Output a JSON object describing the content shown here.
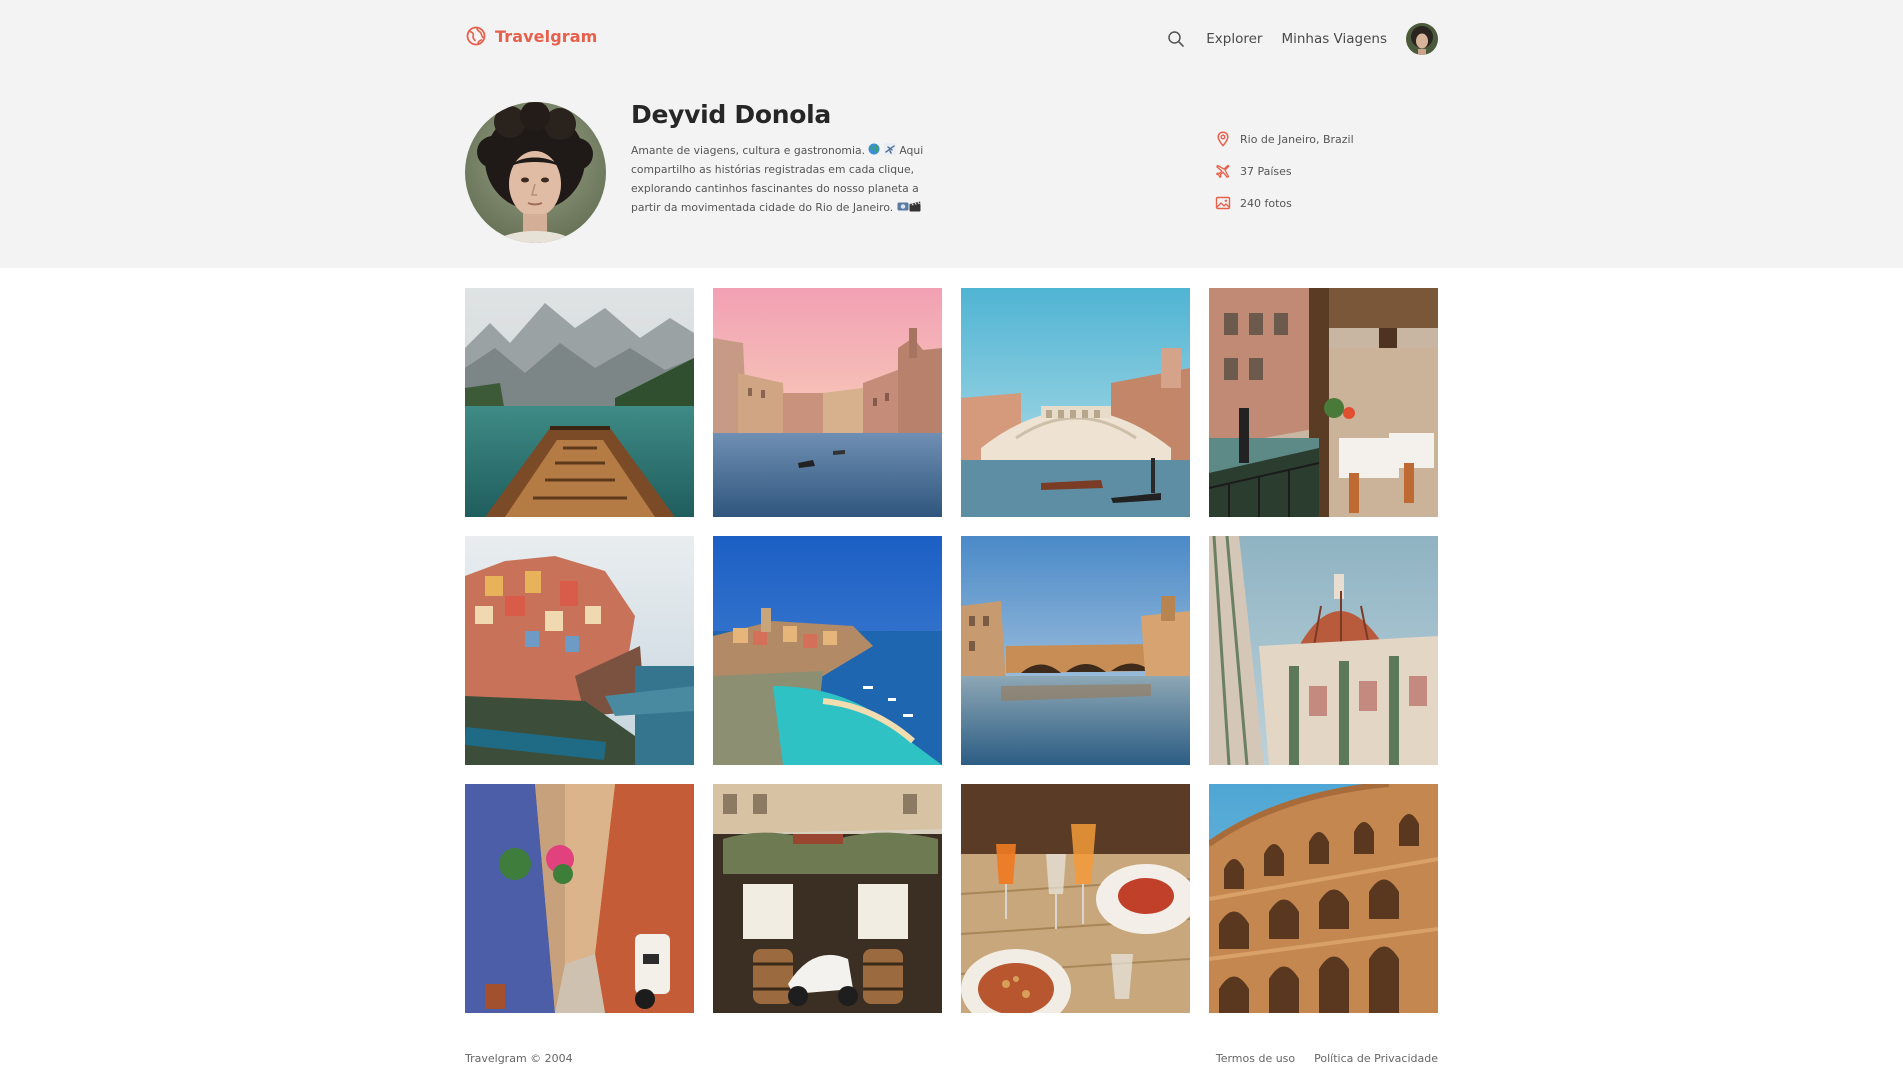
{
  "brand": {
    "name": "Travelgram",
    "accent_color": "#e8604c",
    "icon": "globe-icon"
  },
  "nav": {
    "search_icon": "search-icon",
    "links": [
      {
        "label": "Explorer"
      },
      {
        "label": "Minhas Viagens"
      }
    ],
    "avatar": "user-avatar"
  },
  "profile": {
    "name": "Deyvid Donola",
    "bio": "Amante de viagens, cultura e gastronomia. 🌍✈️ Aqui compartilho as histórias registradas em cada clique, explorando cantinhos fascinantes do nosso planeta a partir da movimentada cidade do Rio de Janeiro. 📷🎬",
    "bio_plain": "Amante de viagens, cultura e gastronomia.",
    "bio_rest": "Aqui compartilho as histórias registradas em cada clique, explorando cantinhos fascinantes do nosso planeta a partir da movimentada cidade do Rio de Janeiro.",
    "stats": [
      {
        "icon": "map-pin-icon",
        "label": "Rio de Janeiro, Brazil"
      },
      {
        "icon": "plane-icon",
        "label": "37 Países"
      },
      {
        "icon": "image-icon",
        "label": "240 fotos"
      }
    ]
  },
  "gallery": {
    "photos": [
      {
        "subject": "lake boat mountains"
      },
      {
        "subject": "venice canal pink sky"
      },
      {
        "subject": "rialto bridge"
      },
      {
        "subject": "venice restaurant canal"
      },
      {
        "subject": "cinque terre manarola"
      },
      {
        "subject": "vernazza harbor"
      },
      {
        "subject": "ponte vecchio florence"
      },
      {
        "subject": "florence duomo"
      },
      {
        "subject": "alley with scooter"
      },
      {
        "subject": "restaurant with vespa"
      },
      {
        "subject": "pasta and aperol"
      },
      {
        "subject": "colosseum"
      }
    ]
  },
  "footer": {
    "copyright": "Travelgram © 2004",
    "links": [
      {
        "label": "Termos de uso"
      },
      {
        "label": "Política de Privacidade"
      }
    ]
  }
}
